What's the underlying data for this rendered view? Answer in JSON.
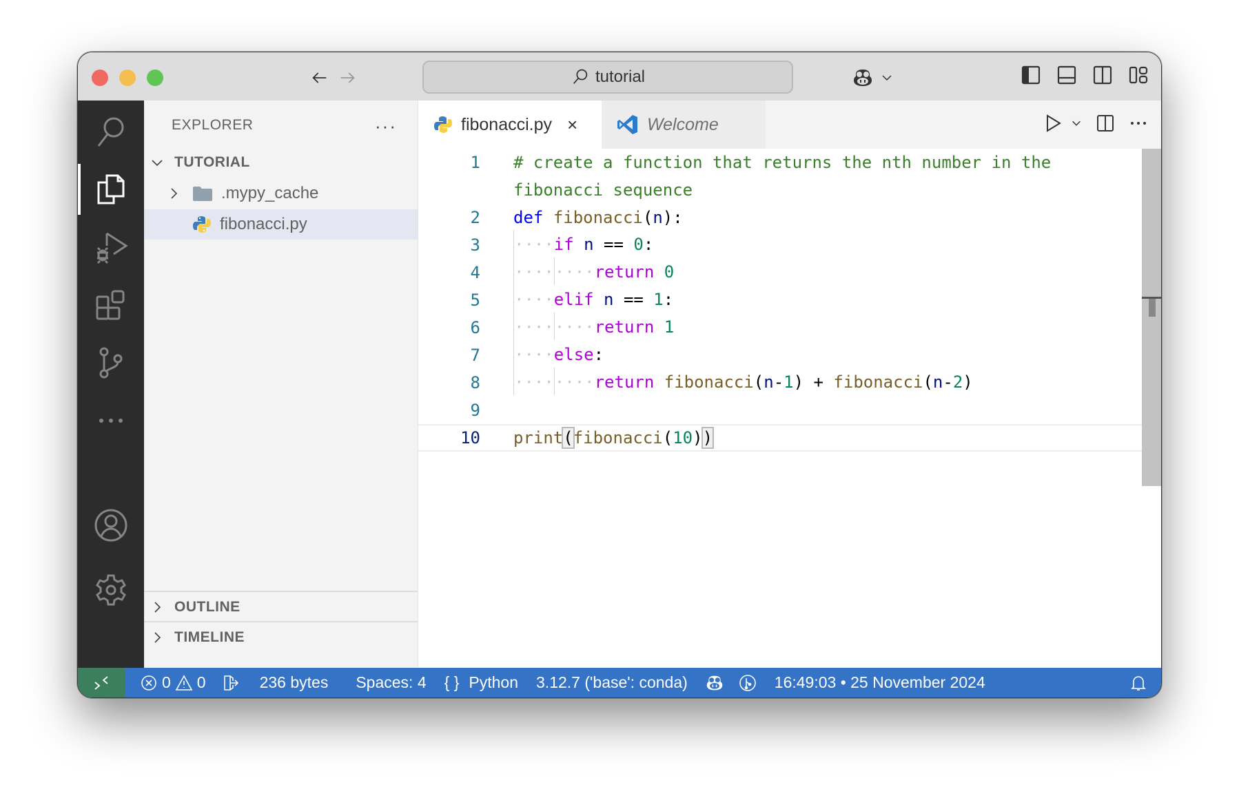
{
  "titlebar": {
    "search_text": "tutorial",
    "nav_back": "back-arrow",
    "nav_forward": "forward-arrow"
  },
  "activity_bar": {
    "items": [
      {
        "name": "search",
        "icon": "search-icon"
      },
      {
        "name": "explorer",
        "icon": "files-icon",
        "active": true
      },
      {
        "name": "run-debug",
        "icon": "run-debug-icon"
      },
      {
        "name": "extensions",
        "icon": "extensions-icon"
      },
      {
        "name": "source-control",
        "icon": "source-control-icon"
      },
      {
        "name": "more",
        "icon": "more-icon"
      }
    ],
    "bottom_items": [
      {
        "name": "accounts",
        "icon": "account-icon"
      },
      {
        "name": "manage",
        "icon": "gear-icon"
      }
    ]
  },
  "sidebar": {
    "title": "EXPLORER",
    "more": "···",
    "folder_name": "TUTORIAL",
    "items": [
      {
        "label": ".mypy_cache",
        "type": "folder",
        "collapsed": true
      },
      {
        "label": "fibonacci.py",
        "type": "python-file",
        "selected": true
      }
    ],
    "sections": [
      {
        "label": "OUTLINE"
      },
      {
        "label": "TIMELINE"
      }
    ]
  },
  "editor": {
    "tabs": [
      {
        "label": "fibonacci.py",
        "active": true,
        "close": "×"
      },
      {
        "label": "Welcome",
        "active": false
      }
    ],
    "lines": [
      {
        "n": "1",
        "text": "# create a function that returns the nth number in the",
        "wrap": "fibonacci sequence"
      },
      {
        "n": "2",
        "text": "def fibonacci(n):"
      },
      {
        "n": "3",
        "text": "    if n == 0:"
      },
      {
        "n": "4",
        "text": "        return 0"
      },
      {
        "n": "5",
        "text": "    elif n == 1:"
      },
      {
        "n": "6",
        "text": "        return 1"
      },
      {
        "n": "7",
        "text": "    else:"
      },
      {
        "n": "8",
        "text": "        return fibonacci(n-1) + fibonacci(n-2)"
      },
      {
        "n": "9",
        "text": ""
      },
      {
        "n": "10",
        "text": "print(fibonacci(10))",
        "current": true
      }
    ],
    "tokens": {
      "l1": "# create a function that returns the nth number in the",
      "l1w": "fibonacci sequence",
      "def": "def",
      "fib": "fibonacci",
      "n": "n",
      "open": "(",
      "close": ")",
      "colon": ":",
      "if": "if",
      "elif": "elif",
      "else": "else",
      "ret": "return",
      "eq": " == ",
      "zero": "0",
      "one": "1",
      "two": "2",
      "ten": "10",
      "minus": "-",
      "plus": " + ",
      "print": "print",
      "dots4": "····"
    }
  },
  "statusbar": {
    "errors": "0",
    "warnings": "0",
    "file_size": "236 bytes",
    "indent": "Spaces: 4",
    "language": "Python",
    "interpreter": "3.12.7 ('base': conda)",
    "datetime": "16:49:03 • 25 November 2024"
  },
  "colors": {
    "statusbar": "#3573c6",
    "remote": "#3b7f5c",
    "activitybar": "#2c2c2c",
    "comment": "#3a7f2a",
    "keyword": "#af00db",
    "function": "#795e26",
    "number": "#098658"
  }
}
